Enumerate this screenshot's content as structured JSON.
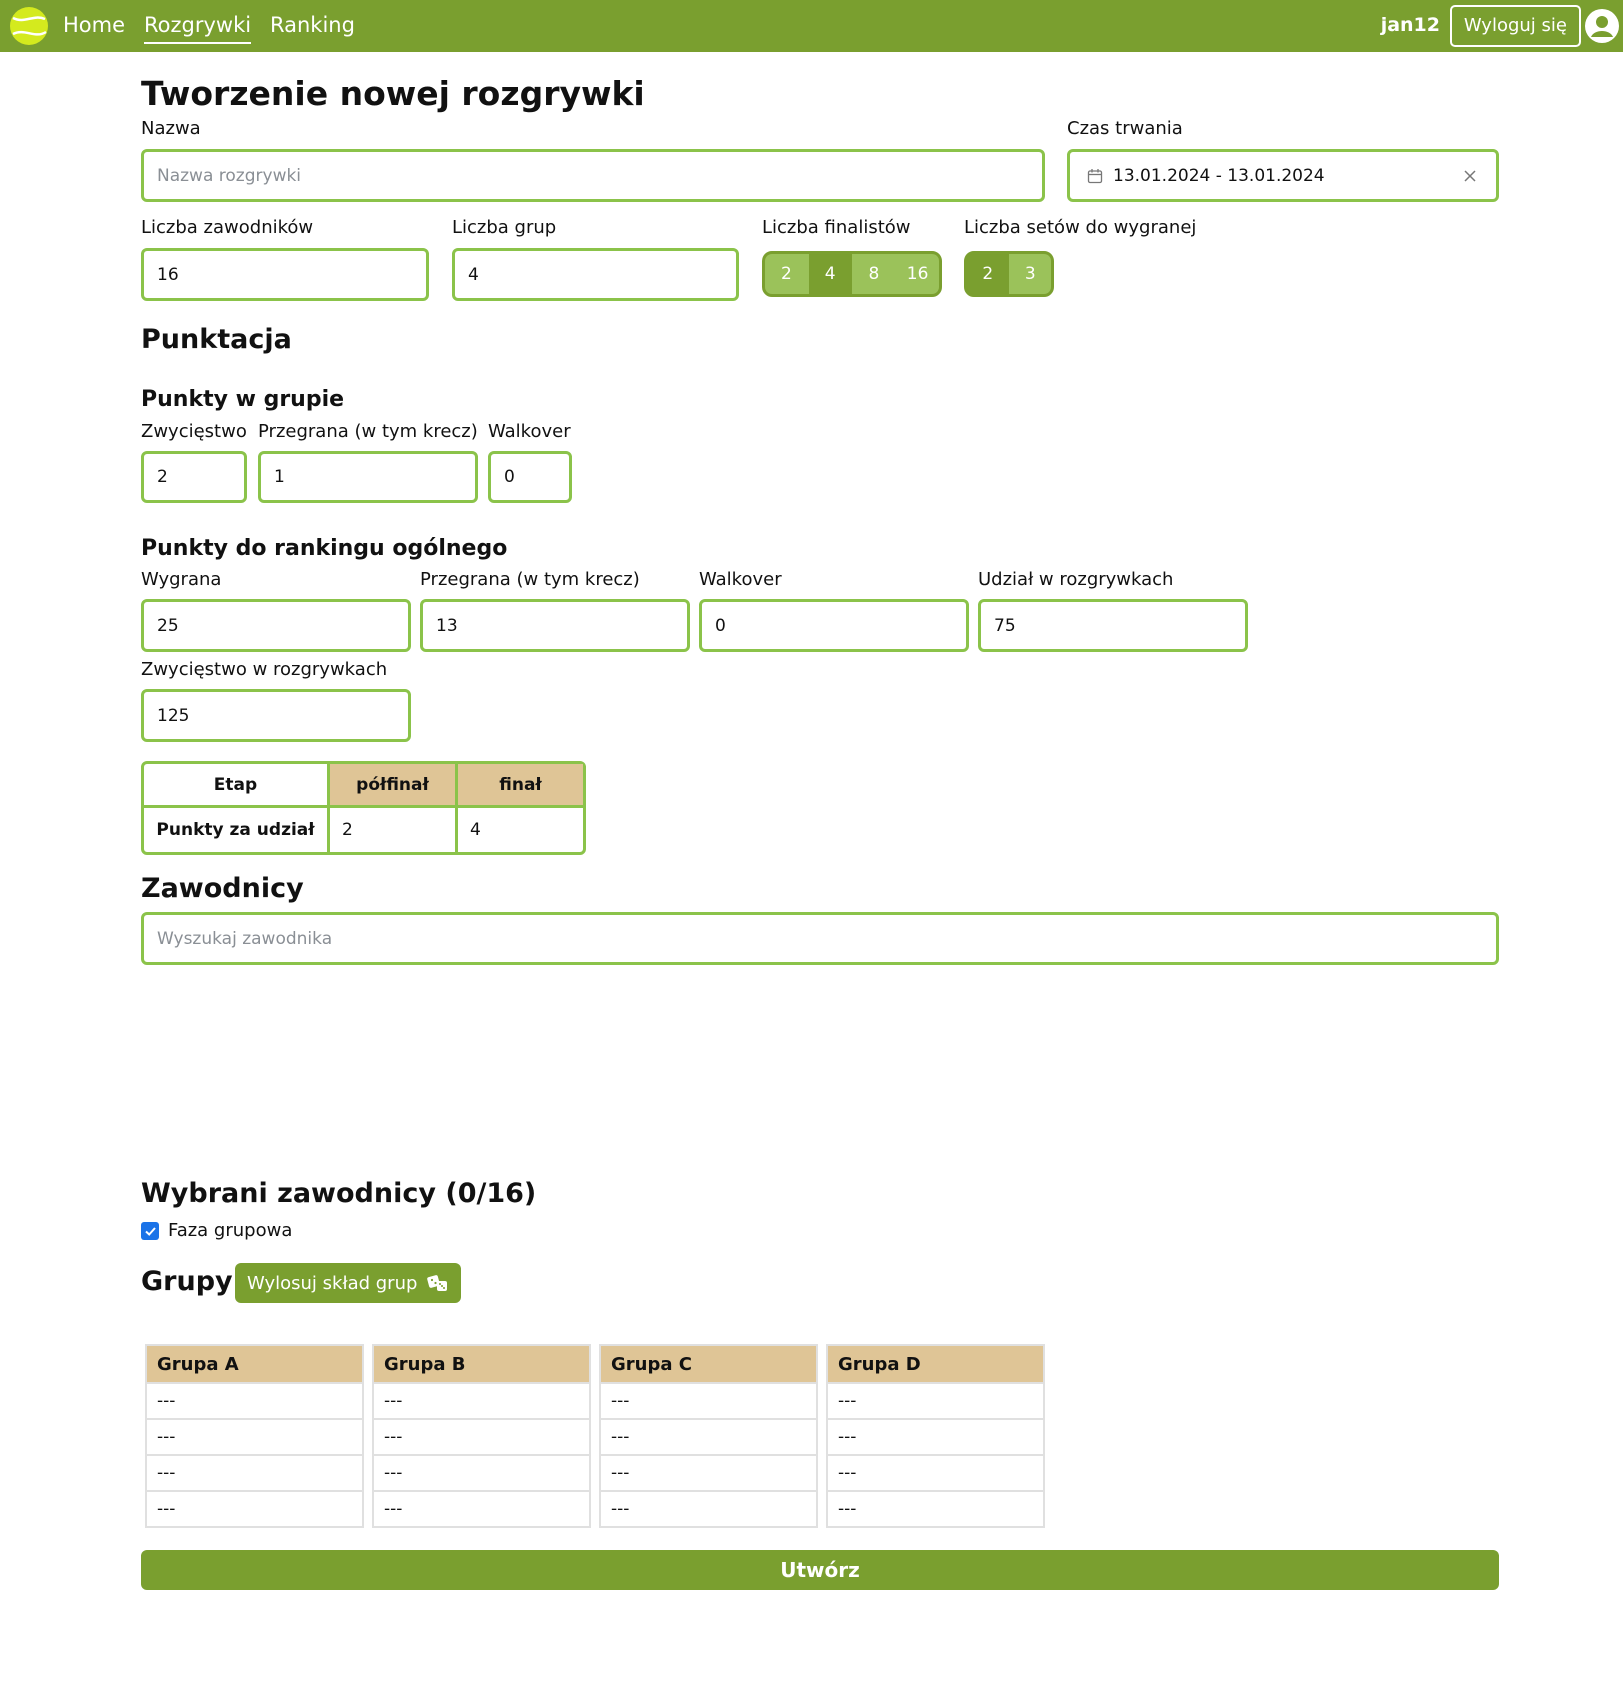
{
  "nav": {
    "links": [
      "Home",
      "Rozgrywki",
      "Ranking"
    ],
    "username": "jan12",
    "logout_label": "Wyloguj się"
  },
  "page_title": "Tworzenie nowej rozgrywki",
  "form": {
    "name_label": "Nazwa",
    "name_placeholder": "Nazwa rozgrywki",
    "duration_label": "Czas trwania",
    "duration_value": "13.01.2024 - 13.01.2024",
    "players_label": "Liczba zawodników",
    "players_value": "16",
    "groups_label": "Liczba grup",
    "groups_value": "4",
    "finalists_label": "Liczba finalistów",
    "finalists_options": [
      "2",
      "4",
      "8",
      "16"
    ],
    "sets_label": "Liczba setów do wygranej",
    "sets_options": [
      "2",
      "3"
    ]
  },
  "scoring": {
    "heading": "Punktacja",
    "group_heading": "Punkty w grupie",
    "group_win_label": "Zwycięstwo",
    "group_win_value": "2",
    "group_loss_label": "Przegrana (w tym krecz)",
    "group_loss_value": "1",
    "group_walkover_label": "Walkover",
    "group_walkover_value": "0",
    "ranking_heading": "Punkty do rankingu ogólnego",
    "r_win_label": "Wygrana",
    "r_win_value": "25",
    "r_loss_label": "Przegrana (w tym krecz)",
    "r_loss_value": "13",
    "r_walkover_label": "Walkover",
    "r_walkover_value": "0",
    "r_participation_label": "Udział w rozgrywkach",
    "r_participation_value": "75",
    "r_tournament_win_label": "Zwycięstwo w rozgrywkach",
    "r_tournament_win_value": "125",
    "stage_table": {
      "header": [
        "Etap",
        "półfinał",
        "finał"
      ],
      "row_label": "Punkty za udział",
      "values": [
        "2",
        "4"
      ]
    }
  },
  "players": {
    "heading": "Zawodnicy",
    "search_placeholder": "Wyszukaj zawodnika",
    "selected_heading": "Wybrani zawodnicy (0/16)",
    "group_phase_label": "Faza grupowa"
  },
  "groups": {
    "heading": "Grupy",
    "draw_label": "Wylosuj skład grup",
    "list": [
      {
        "name": "Grupa A",
        "slots": [
          "---",
          "---",
          "---",
          "---"
        ]
      },
      {
        "name": "Grupa B",
        "slots": [
          "---",
          "---",
          "---",
          "---"
        ]
      },
      {
        "name": "Grupa C",
        "slots": [
          "---",
          "---",
          "---",
          "---"
        ]
      },
      {
        "name": "Grupa D",
        "slots": [
          "---",
          "---",
          "---",
          "---"
        ]
      }
    ]
  },
  "submit_label": "Utwórz",
  "colors": {
    "primary": "#7a9f2f",
    "border": "#8bc34a",
    "light_green": "#9bc25a",
    "table_header": "#dfc596"
  }
}
